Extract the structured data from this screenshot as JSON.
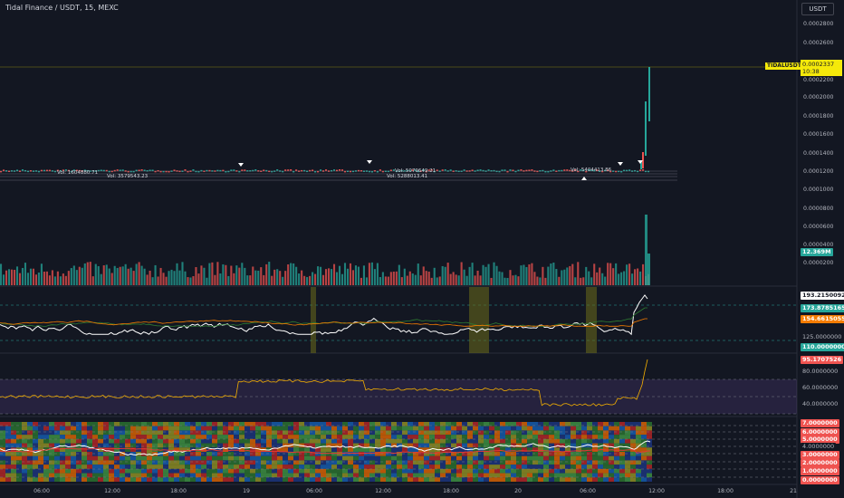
{
  "header": {
    "title": "Tidal Finance / USDT, 15, MEXC",
    "currency_button": "USDT"
  },
  "price_pane": {
    "axis_labels": [
      "0.0002800",
      "0.0002600",
      "0.0002400",
      "0.0002200",
      "0.0002000",
      "0.0001800",
      "0.0001600",
      "0.0001400",
      "0.0001200",
      "0.0001000",
      "0.0000800",
      "0.0000600",
      "0.0000400",
      "0.0000200"
    ],
    "symbol_tag": "TIDALUSDT",
    "last_price": "0.0002337",
    "countdown": "10:38",
    "volume_badge": "12.369M",
    "volume_labels": [
      "Vol: 3579543.23",
      "Vol: 5079649.21",
      "Vol: 5288013.41",
      "Vol: 5404413.86",
      "Vol: 1604880.71"
    ]
  },
  "osc1": {
    "badges": [
      "193.2150092",
      "173.8785165",
      "154.6615055",
      "125.0000000",
      "110.0000000"
    ],
    "badge_colors": [
      "#ffffff",
      "#26a69a",
      "#f57c00",
      "#131722",
      "#26a69a"
    ]
  },
  "osc2": {
    "badges": [
      "95.1707526",
      "80.0000000",
      "60.0000000",
      "40.0000000"
    ],
    "badge_colors": [
      "#ef5350",
      "#131722",
      "#131722",
      "#131722"
    ]
  },
  "osc3": {
    "badges": [
      "7.0000000",
      "6.0000000",
      "5.0000000",
      "4.0000000",
      "3.0000000",
      "2.0000000",
      "1.0000000",
      "0.0000000"
    ],
    "badge_colors": [
      "#ef5350",
      "#ef5350",
      "#ef5350",
      "#131722",
      "#ef5350",
      "#ef5350",
      "#ef5350",
      "#ef5350"
    ]
  },
  "time_axis": {
    "labels": [
      "06:00",
      "12:00",
      "18:00",
      "19",
      "06:00",
      "12:00",
      "18:00",
      "20",
      "06:00",
      "12:00",
      "18:00",
      "21"
    ]
  },
  "colors": {
    "background": "#131722",
    "up": "#26a69a",
    "down": "#ef5350",
    "highlight": "#f5e90a",
    "main_line": "#ffffff",
    "signal_green": "#2e7d32",
    "signal_orange": "#f57c00"
  }
}
